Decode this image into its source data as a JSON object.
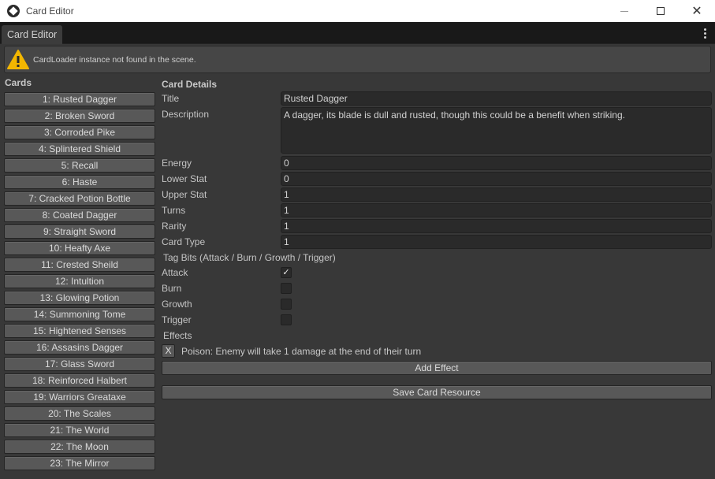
{
  "window": {
    "title": "Card Editor",
    "controls": {
      "minimize": "—",
      "maximize": "☐",
      "close": "✕"
    }
  },
  "tab": {
    "label": "Card Editor"
  },
  "helpbox": {
    "message": "CardLoader instance not found in the scene.",
    "icon": "warning-icon"
  },
  "cards": {
    "heading": "Cards",
    "items": [
      "1: Rusted Dagger",
      "2: Broken Sword",
      "3: Corroded Pike",
      "4: Splintered Shield",
      "5: Recall",
      "6: Haste",
      "7: Cracked Potion Bottle",
      "8: Coated Dagger",
      "9: Straight Sword",
      "10: Heafty Axe",
      "11: Crested Sheild",
      "12: Intultion",
      "13: Glowing Potion",
      "14: Summoning Tome",
      "15: Hightened Senses",
      "16: Assasins Dagger",
      "17: Glass Sword",
      "18: Reinforced Halbert",
      "19: Warriors Greataxe",
      "20: The Scales",
      "21: The World",
      "22: The Moon",
      "23: The Mirror"
    ]
  },
  "details": {
    "heading": "Card Details",
    "title_label": "Title",
    "title_value": "Rusted Dagger",
    "description_label": "Description",
    "description_value": "A dagger, its blade is dull and rusted, though this could be a benefit when striking.",
    "energy_label": "Energy",
    "energy_value": "0",
    "lower_stat_label": "Lower Stat",
    "lower_stat_value": "0",
    "upper_stat_label": "Upper Stat",
    "upper_stat_value": "1",
    "turns_label": "Turns",
    "turns_value": "1",
    "rarity_label": "Rarity",
    "rarity_value": "1",
    "card_type_label": "Card Type",
    "card_type_value": "1",
    "tag_bits_heading": "Tag Bits (Attack / Burn / Growth / Trigger)",
    "tags": {
      "attack": {
        "label": "Attack",
        "checked": true
      },
      "burn": {
        "label": "Burn",
        "checked": false
      },
      "growth": {
        "label": "Growth",
        "checked": false
      },
      "trigger": {
        "label": "Trigger",
        "checked": false
      }
    },
    "effects_heading": "Effects",
    "effects": [
      {
        "remove_label": "X",
        "text": "Poison: Enemy will take 1 damage at the end of their turn"
      }
    ],
    "add_effect_label": "Add Effect",
    "save_label": "Save Card Resource"
  },
  "colors": {
    "background": "#383838",
    "field": "#2a2a2a",
    "button": "#585858",
    "warning": "#f2b600"
  }
}
